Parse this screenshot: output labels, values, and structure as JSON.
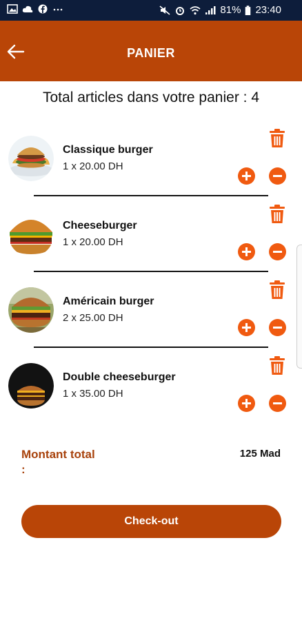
{
  "status_bar": {
    "battery_percent": "81%",
    "time": "23:40",
    "left_icons": [
      "gallery-icon",
      "cloud-icon",
      "facebook-icon",
      "more-dots-icon"
    ],
    "right_icons": [
      "mute-icon",
      "alarm-icon",
      "wifi-icon",
      "signal-icon",
      "battery-icon"
    ]
  },
  "header": {
    "title": "PANIER",
    "back_icon": "arrow-left-icon"
  },
  "cart": {
    "summary": "Total articles dans votre panier : 4",
    "items": [
      {
        "name": "Classique burger",
        "qty_price": "1 x 20.00 DH"
      },
      {
        "name": "Cheeseburger",
        "qty_price": "1 x 20.00 DH"
      },
      {
        "name": "Américain burger",
        "qty_price": "2 x 25.00 DH"
      },
      {
        "name": "Double cheeseburger",
        "qty_price": "1 x 35.00 DH"
      }
    ]
  },
  "totals": {
    "label": "Montant total :",
    "value": "125 Mad"
  },
  "checkout": {
    "label": "Check-out"
  },
  "colors": {
    "brand": "#b94507",
    "status_bar": "#0d1d3b",
    "action_orange": "#f05a10",
    "total_label": "#a8420c"
  }
}
